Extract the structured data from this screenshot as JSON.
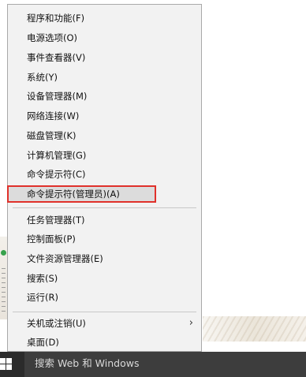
{
  "context_menu": {
    "items": [
      {
        "label": "程序和功能(F)"
      },
      {
        "label": "电源选项(O)"
      },
      {
        "label": "事件查看器(V)"
      },
      {
        "label": "系统(Y)"
      },
      {
        "label": "设备管理器(M)"
      },
      {
        "label": "网络连接(W)"
      },
      {
        "label": "磁盘管理(K)"
      },
      {
        "label": "计算机管理(G)"
      },
      {
        "label": "命令提示符(C)"
      },
      {
        "label": "命令提示符(管理员)(A)"
      },
      {
        "label": "任务管理器(T)"
      },
      {
        "label": "控制面板(P)"
      },
      {
        "label": "文件资源管理器(E)"
      },
      {
        "label": "搜索(S)"
      },
      {
        "label": "运行(R)"
      },
      {
        "label": "关机或注销(U)",
        "submenu_arrow": "›"
      },
      {
        "label": "桌面(D)"
      }
    ],
    "highlight_color": "#e0312b"
  },
  "taskbar": {
    "start_icon": "windows-logo-icon",
    "search_placeholder": "搜索 Web 和 Windows"
  }
}
